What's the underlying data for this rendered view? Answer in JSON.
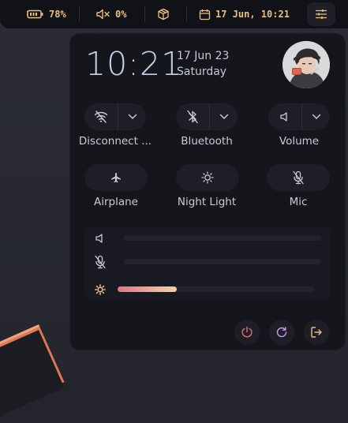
{
  "topbar": {
    "battery_text": "78%",
    "volume_text": "0%",
    "datetime_text": "17 Jun, 10:21",
    "accent_color": "#e8c07a"
  },
  "panel": {
    "clock": "10:21",
    "date": "17 Jun 23",
    "day": "Saturday",
    "toggles": [
      {
        "label": "Disconnect ...",
        "icon": "wifi-off-icon"
      },
      {
        "label": "Bluetooth",
        "icon": "bluetooth-off-icon"
      },
      {
        "label": "Volume",
        "icon": "volume-icon"
      },
      {
        "label": "Airplane",
        "icon": "airplane-icon"
      },
      {
        "label": "Night Light",
        "icon": "sun-icon"
      },
      {
        "label": "Mic",
        "icon": "mic-off-icon"
      }
    ],
    "sliders": {
      "volume_level": 0,
      "mic_level": 0,
      "brightness_level": 0.3
    },
    "actions": [
      "power-icon",
      "restart-icon",
      "logout-icon"
    ],
    "colors": {
      "power": "#e0707e",
      "restart": "#c99ae8",
      "logout": "#e8c07a"
    }
  }
}
